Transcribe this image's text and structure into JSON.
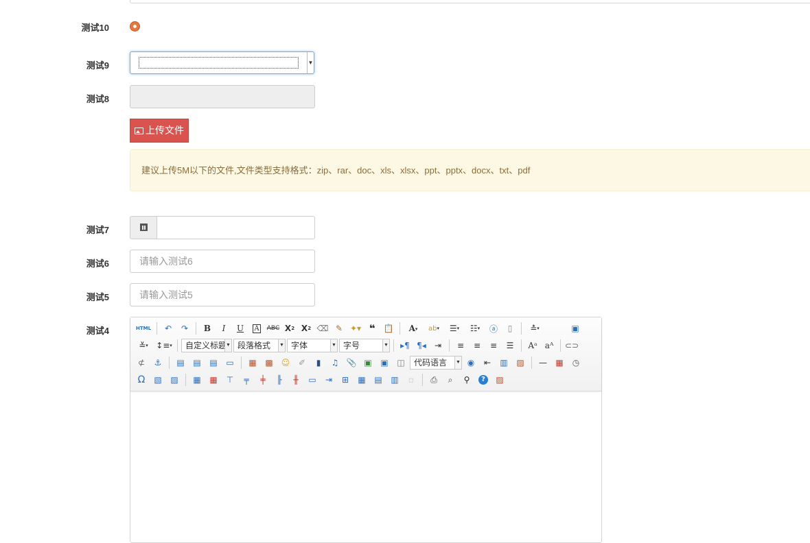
{
  "fields": {
    "test10": {
      "label": "测试10"
    },
    "test9": {
      "label": "测试9"
    },
    "test8": {
      "label": "测试8"
    },
    "upload": {
      "label": "上传文件",
      "hint": "建议上传5M以下的文件,文件类型支持格式：zip、rar、doc、xls、xlsx、ppt、pptx、docx、txt、pdf"
    },
    "test7": {
      "label": "测试7"
    },
    "test6": {
      "label": "测试6",
      "placeholder": "请输入测试6"
    },
    "test5": {
      "label": "测试5",
      "placeholder": "请输入测试5"
    },
    "test4": {
      "label": "测试4"
    }
  },
  "editor": {
    "combos": {
      "custom_heading": "自定义标题",
      "paragraph": "段落格式",
      "font_family": "字体",
      "font_size": "字号",
      "code_language": "代码语言"
    },
    "html_label": "HTML",
    "colors": {
      "accent_danger": "#d9534f",
      "focus": "#66afe9",
      "alert_bg": "#fcf8e3",
      "alert_text": "#8a6d3b"
    }
  }
}
